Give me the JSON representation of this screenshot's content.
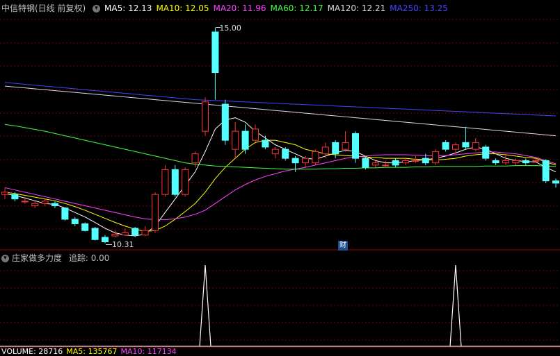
{
  "header": {
    "title": "中信特钢(日线 前复权)",
    "ma": [
      {
        "label": "MA5: 12.13",
        "color": "#ffffff"
      },
      {
        "label": "MA10: 12.05",
        "color": "#ffff00"
      },
      {
        "label": "MA20: 11.96",
        "color": "#ff44ff"
      },
      {
        "label": "MA60: 12.17",
        "color": "#44ff44"
      },
      {
        "label": "MA120: 12.21",
        "color": "#dddddd"
      },
      {
        "label": "MA250: 13.25",
        "color": "#4444ff"
      }
    ]
  },
  "indicator": {
    "title": "庄家做多力度",
    "track_label": "追踪: 0.00"
  },
  "volume": {
    "labels": [
      {
        "label": "VOLUME: 28716",
        "color": "#ffffff"
      },
      {
        "label": "MA5: 135767",
        "color": "#ffff00"
      },
      {
        "label": "MA10: 117134",
        "color": "#ff44ff"
      }
    ]
  },
  "annotations": {
    "high": "15.00",
    "low": "10.31",
    "badge": "财"
  },
  "colors": {
    "up": "#ff3333",
    "down": "#54ffff",
    "grid": "#800000"
  },
  "chart_data": {
    "type": "candlestick",
    "ylim": [
      10.15,
      15.3
    ],
    "candles": [
      [
        11.3,
        11.35,
        11.45,
        11.2
      ],
      [
        11.3,
        11.2,
        11.35,
        11.15
      ],
      [
        11.15,
        11.15,
        11.25,
        11.1
      ],
      [
        11.05,
        11.1,
        11.15,
        11.0
      ],
      [
        11.1,
        11.15,
        11.2,
        11.05
      ],
      [
        11.1,
        11.05,
        11.15,
        11.0
      ],
      [
        11.0,
        10.75,
        11.02,
        10.72
      ],
      [
        10.75,
        10.65,
        10.8,
        10.6
      ],
      [
        10.65,
        10.5,
        10.68,
        10.48
      ],
      [
        10.55,
        10.3,
        10.58,
        10.28
      ],
      [
        10.35,
        10.25,
        10.4,
        10.22
      ],
      [
        10.38,
        10.42,
        10.5,
        10.35
      ],
      [
        10.4,
        10.45,
        10.55,
        10.38
      ],
      [
        10.55,
        10.4,
        10.58,
        10.36
      ],
      [
        10.4,
        10.5,
        10.6,
        10.38
      ],
      [
        10.5,
        11.3,
        11.35,
        10.45
      ],
      [
        11.3,
        11.85,
        11.95,
        11.25
      ],
      [
        11.85,
        11.3,
        11.95,
        11.25
      ],
      [
        11.3,
        11.85,
        11.9,
        11.25
      ],
      [
        12.0,
        12.2,
        12.25,
        11.9
      ],
      [
        12.7,
        13.35,
        13.45,
        12.6
      ],
      [
        14.9,
        14.0,
        15.0,
        13.4
      ],
      [
        13.3,
        12.5,
        13.4,
        12.4
      ],
      [
        12.3,
        12.7,
        12.9,
        12.1
      ],
      [
        12.7,
        12.3,
        12.85,
        12.2
      ],
      [
        12.5,
        12.75,
        12.85,
        12.45
      ],
      [
        12.5,
        12.35,
        12.6,
        12.3
      ],
      [
        12.2,
        12.3,
        12.35,
        12.1
      ],
      [
        12.3,
        12.1,
        12.35,
        12.05
      ],
      [
        12.1,
        12.0,
        12.15,
        11.8
      ],
      [
        12.0,
        12.1,
        12.15,
        11.9
      ],
      [
        12.0,
        12.25,
        12.3,
        11.95
      ],
      [
        12.2,
        12.35,
        12.45,
        12.1
      ],
      [
        12.45,
        12.2,
        12.5,
        12.1
      ],
      [
        12.3,
        12.45,
        12.7,
        12.25
      ],
      [
        12.65,
        12.1,
        12.7,
        12.0
      ],
      [
        12.1,
        11.9,
        12.15,
        11.85
      ],
      [
        11.95,
        12.0,
        12.05,
        11.9
      ],
      [
        11.95,
        11.95,
        12.05,
        11.9
      ],
      [
        12.05,
        11.95,
        12.1,
        11.9
      ],
      [
        12.0,
        12.05,
        12.1,
        11.95
      ],
      [
        12.05,
        12.05,
        12.15,
        12.0
      ],
      [
        12.1,
        12.0,
        12.2,
        11.95
      ],
      [
        12.0,
        12.25,
        12.3,
        11.95
      ],
      [
        12.45,
        12.3,
        12.5,
        12.25
      ],
      [
        12.3,
        12.4,
        12.45,
        12.2
      ],
      [
        12.45,
        12.35,
        12.8,
        12.3
      ],
      [
        12.3,
        12.45,
        12.55,
        12.25
      ],
      [
        12.35,
        12.1,
        12.4,
        12.05
      ],
      [
        12.05,
        12.0,
        12.1,
        11.95
      ],
      [
        12.0,
        12.05,
        12.2,
        11.95
      ],
      [
        12.0,
        12.05,
        12.1,
        11.95
      ],
      [
        12.05,
        12.0,
        12.1,
        11.95
      ],
      [
        12.05,
        12.05,
        12.1,
        12.0
      ],
      [
        12.05,
        11.6,
        12.08,
        11.55
      ],
      [
        11.6,
        11.55,
        11.65,
        11.45
      ]
    ],
    "ma": {
      "MA5": [
        11.32,
        11.28,
        11.22,
        11.16,
        11.1,
        11.08,
        11.0,
        10.9,
        10.8,
        10.68,
        10.55,
        10.45,
        10.4,
        10.38,
        10.42,
        10.6,
        10.9,
        11.2,
        11.5,
        11.8,
        12.25,
        12.75,
        12.95,
        13.0,
        12.9,
        12.7,
        12.55,
        12.4,
        12.3,
        12.2,
        12.1,
        12.08,
        12.15,
        12.22,
        12.28,
        12.25,
        12.15,
        12.05,
        12.0,
        12.0,
        12.02,
        12.05,
        12.07,
        12.1,
        12.15,
        12.22,
        12.3,
        12.35,
        12.3,
        12.2,
        12.1,
        12.05,
        12.03,
        12.02,
        11.9,
        11.8
      ],
      "MA10": [
        11.35,
        11.32,
        11.28,
        11.24,
        11.2,
        11.16,
        11.1,
        11.03,
        10.95,
        10.86,
        10.77,
        10.68,
        10.6,
        10.53,
        10.48,
        10.5,
        10.6,
        10.75,
        10.92,
        11.1,
        11.35,
        11.65,
        11.9,
        12.1,
        12.3,
        12.45,
        12.5,
        12.5,
        12.45,
        12.4,
        12.3,
        12.25,
        12.2,
        12.18,
        12.16,
        12.15,
        12.13,
        12.12,
        12.1,
        12.1,
        12.1,
        12.08,
        12.07,
        12.06,
        12.08,
        12.1,
        12.15,
        12.18,
        12.2,
        12.2,
        12.18,
        12.15,
        12.12,
        12.1,
        12.02,
        11.95
      ],
      "MA20": [
        11.45,
        11.4,
        11.35,
        11.3,
        11.25,
        11.2,
        11.15,
        11.1,
        11.05,
        11.0,
        10.95,
        10.9,
        10.85,
        10.8,
        10.76,
        10.74,
        10.74,
        10.76,
        10.8,
        10.86,
        10.95,
        11.1,
        11.25,
        11.4,
        11.52,
        11.62,
        11.7,
        11.76,
        11.82,
        11.86,
        11.9,
        11.95,
        12.0,
        12.05,
        12.1,
        12.13,
        12.15,
        12.17,
        12.18,
        12.18,
        12.18,
        12.17,
        12.16,
        12.16,
        12.16,
        12.18,
        12.2,
        12.22,
        12.24,
        12.24,
        12.22,
        12.2,
        12.16,
        12.12,
        12.05,
        11.98
      ],
      "MA60": [
        12.85,
        12.82,
        12.78,
        12.74,
        12.7,
        12.65,
        12.6,
        12.55,
        12.5,
        12.45,
        12.4,
        12.35,
        12.3,
        12.25,
        12.2,
        12.15,
        12.1,
        12.05,
        12.0,
        11.97,
        11.95,
        11.93,
        11.92,
        11.91,
        11.9,
        11.89,
        11.88,
        11.87,
        11.86,
        11.86,
        11.86,
        11.86,
        11.87,
        11.87,
        11.88,
        11.88,
        11.89,
        11.89,
        11.9,
        11.9,
        11.9,
        11.91,
        11.91,
        11.92,
        11.92,
        11.92,
        11.92,
        11.92,
        11.93,
        11.93,
        11.93,
        11.94,
        11.94,
        11.94,
        11.93,
        11.92
      ],
      "MA120": [
        13.7,
        13.68,
        13.66,
        13.64,
        13.62,
        13.6,
        13.58,
        13.56,
        13.54,
        13.52,
        13.5,
        13.48,
        13.46,
        13.44,
        13.42,
        13.4,
        13.38,
        13.36,
        13.34,
        13.32,
        13.3,
        13.28,
        13.26,
        13.24,
        13.22,
        13.2,
        13.18,
        13.16,
        13.14,
        13.12,
        13.1,
        13.08,
        13.06,
        13.04,
        13.02,
        13.0,
        12.98,
        12.96,
        12.94,
        12.92,
        12.9,
        12.88,
        12.86,
        12.84,
        12.82,
        12.8,
        12.78,
        12.76,
        12.74,
        12.72,
        12.7,
        12.68,
        12.66,
        12.64,
        12.62,
        12.6
      ],
      "MA250": [
        13.78,
        13.76,
        13.74,
        13.72,
        13.7,
        13.68,
        13.66,
        13.64,
        13.62,
        13.6,
        13.58,
        13.56,
        13.54,
        13.52,
        13.5,
        13.48,
        13.46,
        13.44,
        13.42,
        13.4,
        13.39,
        13.38,
        13.37,
        13.36,
        13.35,
        13.34,
        13.33,
        13.32,
        13.31,
        13.3,
        13.29,
        13.28,
        13.27,
        13.26,
        13.25,
        13.24,
        13.23,
        13.22,
        13.21,
        13.2,
        13.19,
        13.18,
        13.17,
        13.16,
        13.15,
        13.14,
        13.13,
        13.12,
        13.11,
        13.1,
        13.09,
        13.08,
        13.07,
        13.06,
        13.05,
        13.04
      ]
    },
    "indicator_values": [
      0,
      0,
      0,
      0,
      0,
      0,
      0,
      0,
      0,
      0,
      0,
      0,
      0,
      0,
      0,
      0,
      0,
      0,
      0,
      0,
      1,
      0,
      0,
      0,
      0,
      0,
      0,
      0,
      0,
      0,
      0,
      0,
      0,
      0,
      0,
      0,
      0,
      0,
      0,
      0,
      0,
      0,
      0,
      0,
      0,
      1,
      0,
      0,
      0,
      0,
      0,
      0,
      0,
      0,
      0,
      0
    ]
  }
}
